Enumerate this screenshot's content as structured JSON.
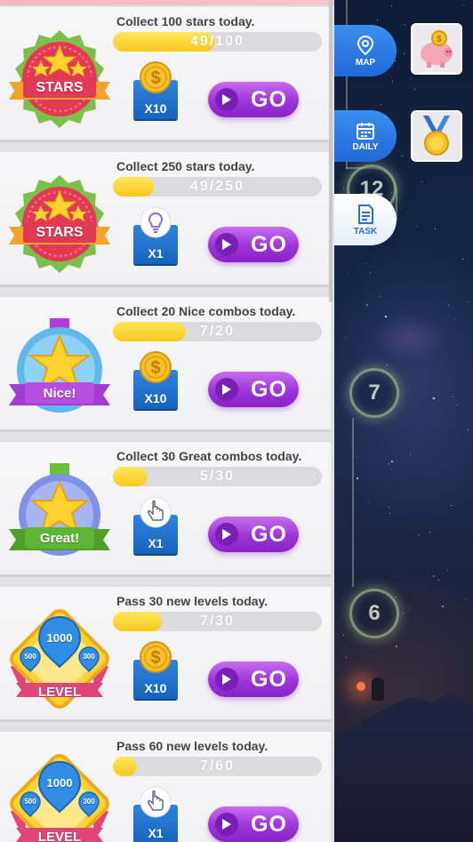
{
  "nav": {
    "map_label": "MAP",
    "daily_label": "DAILY",
    "task_label": "TASK"
  },
  "map_levels": [
    "12",
    "7",
    "6"
  ],
  "tasks": [
    {
      "title": "Collect 100 stars today.",
      "progress_text": "49/100",
      "progress_value": 0.49,
      "badge": "stars-badge",
      "badge_label": "STARS",
      "reward_icon": "coin-icon",
      "reward_count": "X10",
      "go_label": "GO"
    },
    {
      "title": "Collect 250 stars today.",
      "progress_text": "49/250",
      "progress_value": 0.196,
      "badge": "stars-badge",
      "badge_label": "STARS",
      "reward_icon": "lightbulb-icon",
      "reward_count": "X1",
      "go_label": "GO"
    },
    {
      "title": "Collect 20 Nice combos today.",
      "progress_text": "7/20",
      "progress_value": 0.35,
      "badge": "nice-medal-badge",
      "badge_label": "Nice!",
      "reward_icon": "coin-icon",
      "reward_count": "X10",
      "go_label": "GO"
    },
    {
      "title": "Collect 30 Great combos today.",
      "progress_text": "5/30",
      "progress_value": 0.167,
      "badge": "great-medal-badge",
      "badge_label": "Great!",
      "reward_icon": "pointer-hand-icon",
      "reward_count": "X1",
      "go_label": "GO"
    },
    {
      "title": "Pass 30 new levels today.",
      "progress_text": "7/30",
      "progress_value": 0.233,
      "badge": "level-badge",
      "badge_label": "LEVEL",
      "badge_numbers": [
        "1000",
        "500",
        "300"
      ],
      "reward_icon": "coin-icon",
      "reward_count": "X10",
      "go_label": "GO"
    },
    {
      "title": "Pass 60 new levels today.",
      "progress_text": "7/60",
      "progress_value": 0.117,
      "badge": "level-badge",
      "badge_label": "LEVEL",
      "badge_numbers": [
        "1000",
        "500",
        "300"
      ],
      "reward_icon": "pointer-hand-icon",
      "reward_count": "X1",
      "go_label": "GO"
    }
  ],
  "colors": {
    "go_button": "#9b35d6",
    "progress_fill": "#f8c81d",
    "reward_box": "#1762bd",
    "nav_button": "#2068d8"
  }
}
